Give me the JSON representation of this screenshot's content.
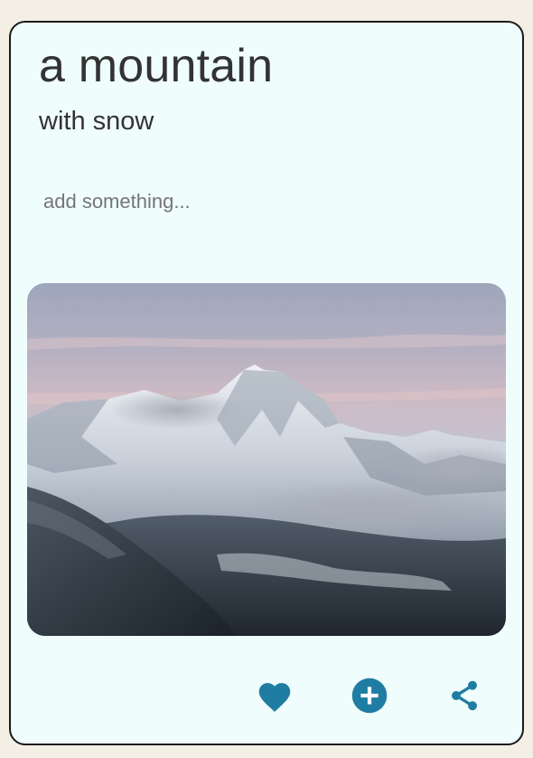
{
  "card": {
    "title": "a mountain",
    "subtitle": "with snow",
    "note_placeholder": "add something...",
    "note_value": ""
  },
  "photo": {
    "subject": "snow-capped mountain peak with clouds"
  },
  "actions": [
    {
      "name": "like",
      "icon": "heart-icon"
    },
    {
      "name": "add",
      "icon": "plus-circle-icon"
    },
    {
      "name": "share",
      "icon": "share-icon"
    }
  ],
  "colors": {
    "page_background": "#f3efe4",
    "card_background": "#f0fdfd",
    "card_border": "#1a1a1a",
    "text": "#333333",
    "placeholder": "#757575",
    "accent": "#1f7da3"
  }
}
